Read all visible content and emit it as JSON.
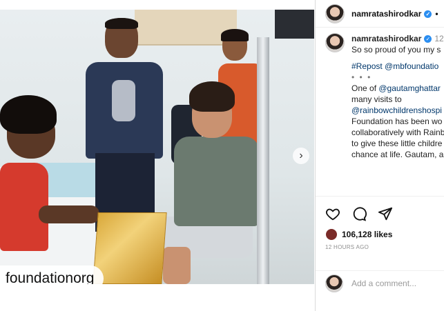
{
  "post": {
    "username": "namratashirodkar",
    "header_separator": "•",
    "watermark": "foundationorg",
    "caption": {
      "username": "namratashirodkar",
      "time": "12",
      "lines": [
        {
          "text": "So so proud of you my s",
          "kind": "text"
        },
        {
          "text": "",
          "kind": "gap"
        },
        {
          "text": "#Repost @mbfoundatio",
          "kind": "tag"
        },
        {
          "text": "• • •",
          "kind": "dots"
        },
        {
          "text": "One of @gautamghattar",
          "kind": "mixed",
          "plain": "One of ",
          "tag": "@gautamghattar"
        },
        {
          "text": "many visits to",
          "kind": "text"
        },
        {
          "text": "@rainbowchildrenshospi",
          "kind": "tag"
        },
        {
          "text": "Foundation has been wo",
          "kind": "text"
        },
        {
          "text": "collaboratively with Rainb",
          "kind": "text"
        },
        {
          "text": "to give these little childre",
          "kind": "text"
        },
        {
          "text": "chance at life. Gautam, a",
          "kind": "text"
        }
      ]
    },
    "actions": {
      "like_icon": "heart-icon",
      "comment_icon": "comment-icon",
      "share_icon": "paper-plane-icon"
    },
    "likes": "106,128 likes",
    "posted_ago": "12 HOURS AGO",
    "comment_placeholder": "Add a comment...",
    "colors": {
      "link": "#00376b",
      "verified": "#2b8ef1",
      "muted": "#8e8e8e"
    }
  }
}
